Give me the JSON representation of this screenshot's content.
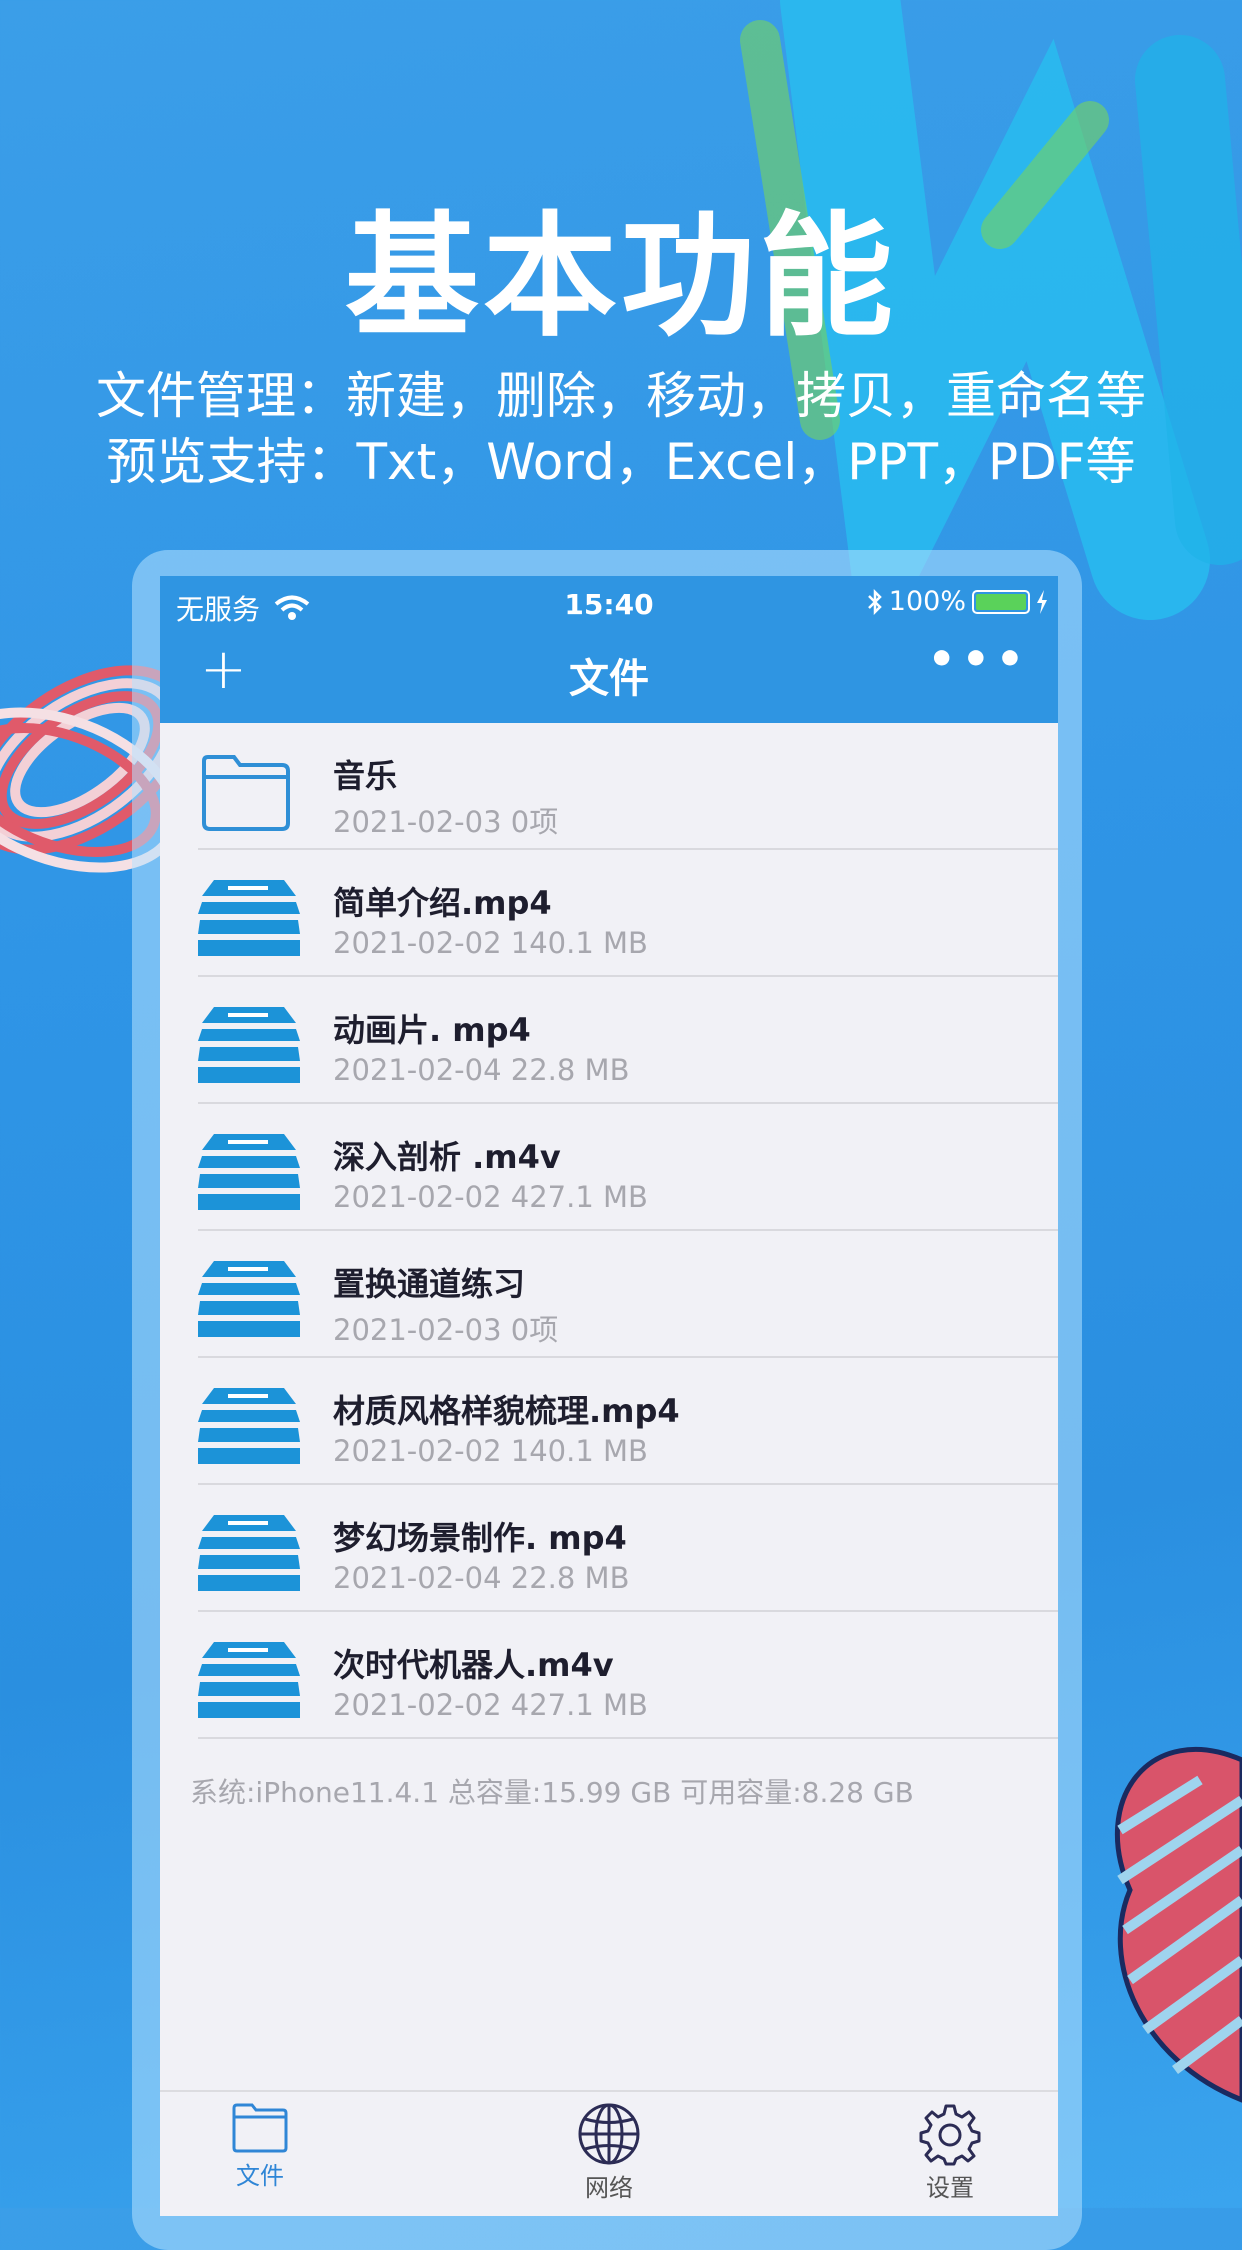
{
  "promo": {
    "headline": "基本功能",
    "line1": "文件管理：新建，删除，移动，拷贝，重命名等",
    "line2": "预览支持：Txt，Word，Excel，PPT，PDF等"
  },
  "status_bar": {
    "carrier": "无服务",
    "time": "15:40",
    "battery": "100%",
    "battery_level": 1.0
  },
  "navbar": {
    "add_label": "+",
    "title": "文件",
    "more_label": "•••"
  },
  "files": [
    {
      "name": "音乐",
      "date": "2021-02-03",
      "size": "0项",
      "type": "folder"
    },
    {
      "name": "简单介绍.mp4",
      "date": "2021-02-02",
      "size": "140.1 MB",
      "type": "video"
    },
    {
      "name": "动画片. mp4",
      "date": "2021-02-04",
      "size": "22.8  MB",
      "type": "video"
    },
    {
      "name": "深入剖析 .m4v",
      "date": "2021-02-02",
      "size": "427.1 MB",
      "type": "video"
    },
    {
      "name": "置换通道练习",
      "date": "2021-02-03",
      "size": "0项",
      "type": "video"
    },
    {
      "name": "材质风格样貌梳理.mp4",
      "date": "2021-02-02",
      "size": "140.1 MB",
      "type": "video"
    },
    {
      "name": "梦幻场景制作. mp4",
      "date": "2021-02-04",
      "size": "22.8  MB",
      "type": "video"
    },
    {
      "name": "次时代机器人.m4v",
      "date": "2021-02-02",
      "size": "427.1 MB",
      "type": "video"
    }
  ],
  "system_info": "系统:iPhone11.4.1  总容量:15.99 GB   可用容量:8.28 GB",
  "tabs": [
    {
      "label": "文件",
      "icon": "folder-icon",
      "active": true
    },
    {
      "label": "网络",
      "icon": "globe-icon",
      "active": false
    },
    {
      "label": "设置",
      "icon": "gear-icon",
      "active": false
    }
  ],
  "colors": {
    "navbar": "#2f95e2",
    "accent": "#2f86d6",
    "background": "#f1f1f6"
  }
}
